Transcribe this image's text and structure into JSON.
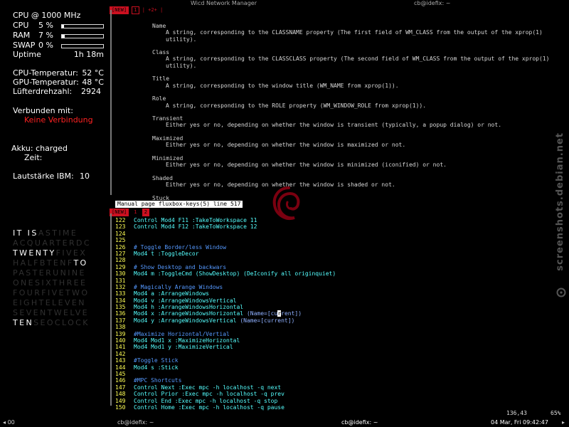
{
  "conky": {
    "cpu_header": "CPU @ 1000 MHz",
    "rows": [
      {
        "label": "CPU",
        "value": "5 %",
        "percent": 5
      },
      {
        "label": "RAM",
        "value": "7 %",
        "percent": 7
      },
      {
        "label": "SWAP",
        "value": "0 %",
        "percent": 0
      }
    ],
    "uptime_label": "Uptime",
    "uptime_value": "1h 18m",
    "cpu_temp_label": "CPU-Temperatur:",
    "cpu_temp_value": "52 °C",
    "gpu_temp_label": "GPU-Temperatur:",
    "gpu_temp_value": "48 °C",
    "fan_label": "Lüfterdrehzahl:",
    "fan_value": "2924",
    "connected_label": "Verbunden mit:",
    "connected_value": "Keine Verbindung",
    "battery_label": "Akku: charged",
    "time_label": "Zeit:",
    "volume_label": "Lautstärke IBM:",
    "volume_value": "10"
  },
  "word_clock": [
    [
      {
        "t": "IT",
        "on": true
      },
      {
        "t": " ",
        "on": false
      },
      {
        "t": "IS",
        "on": true
      },
      {
        "t": "ASTIME",
        "on": false
      }
    ],
    [
      {
        "t": "ACQUARTERDC",
        "on": false
      }
    ],
    [
      {
        "t": "TWENTY",
        "on": true
      },
      {
        "t": "FIVEX",
        "on": false
      }
    ],
    [
      {
        "t": "HALFBTENF",
        "on": false
      },
      {
        "t": "TO",
        "on": true
      }
    ],
    [
      {
        "t": "PASTERUNINE",
        "on": false
      }
    ],
    [
      {
        "t": "ONESIXTHREE",
        "on": false
      }
    ],
    [
      {
        "t": "FOURFIVETWO",
        "on": false
      }
    ],
    [
      {
        "t": "EIGHTELEVEN",
        "on": false
      }
    ],
    [
      {
        "t": "SEVENTWELVE",
        "on": false
      }
    ],
    [
      {
        "t": "TEN",
        "on": true
      },
      {
        "t": "SEOCLOCK",
        "on": false
      }
    ]
  ],
  "window": {
    "title": "Wicd Network Manager",
    "terminal_title": "cb@idefix: ~"
  },
  "top_tabs": {
    "a": "[NEW]",
    "b": "1",
    "rest": "| +2+ |"
  },
  "man_page": [
    {
      "text": "Name",
      "indent": 0
    },
    {
      "text": "A string, corresponding to the CLASSNAME property (The first field of WM_CLASS from the output of the xprop(1)",
      "indent": 1
    },
    {
      "text": "utility).",
      "indent": 1
    },
    {
      "text": "",
      "indent": 0
    },
    {
      "text": "Class",
      "indent": 0
    },
    {
      "text": "A string, corresponding to the CLASSCLASS property (The second field of WM_CLASS from the output of the xprop(1)",
      "indent": 1
    },
    {
      "text": "utility).",
      "indent": 1
    },
    {
      "text": "",
      "indent": 0
    },
    {
      "text": "Title",
      "indent": 0
    },
    {
      "text": "A string, corresponding to the window title (WM_NAME from xprop(1)).",
      "indent": 1
    },
    {
      "text": "",
      "indent": 0
    },
    {
      "text": "Role",
      "indent": 0
    },
    {
      "text": "A string, corresponding to the ROLE property (WM_WINDOW_ROLE from xprop(1)).",
      "indent": 1
    },
    {
      "text": "",
      "indent": 0
    },
    {
      "text": "Transient",
      "indent": 0
    },
    {
      "text": "Either yes or no, depending on whether the window is transient (typically, a popup dialog) or not.",
      "indent": 1
    },
    {
      "text": "",
      "indent": 0
    },
    {
      "text": "Maximized",
      "indent": 0
    },
    {
      "text": "Either yes or no, depending on whether the window is maximized or not.",
      "indent": 1
    },
    {
      "text": "",
      "indent": 0
    },
    {
      "text": "Minimized",
      "indent": 0
    },
    {
      "text": "Either yes or no, depending on whether the window is minimized (iconified) or not.",
      "indent": 1
    },
    {
      "text": "",
      "indent": 0
    },
    {
      "text": "Shaded",
      "indent": 0
    },
    {
      "text": "Either yes or no, depending on whether the window is shaded or not.",
      "indent": 1
    },
    {
      "text": "",
      "indent": 0
    },
    {
      "text": "Stuck",
      "indent": 0
    }
  ],
  "man_status": "Manual page fluxbox-keys(5) line 517",
  "mid_tabs": {
    "a": "[NEW]",
    "b": "1",
    "c": "2"
  },
  "vim_lines": [
    {
      "n": "122",
      "parts": [
        {
          "c": "kw",
          "t": "Control Mod4 F11 :TakeToWorkspace 11"
        }
      ]
    },
    {
      "n": "123",
      "parts": [
        {
          "c": "kw",
          "t": "Control Mod4 F12 :TakeToWorkspace 12"
        }
      ]
    },
    {
      "n": "124",
      "parts": []
    },
    {
      "n": "125",
      "parts": []
    },
    {
      "n": "126",
      "parts": [
        {
          "c": "cm",
          "t": "# Toggle Border/less Window"
        }
      ]
    },
    {
      "n": "127",
      "parts": [
        {
          "c": "kw",
          "t": "Mod4 t :ToggleDecor"
        }
      ]
    },
    {
      "n": "128",
      "parts": []
    },
    {
      "n": "129",
      "parts": [
        {
          "c": "cm",
          "t": "# Show Desktop and backwars"
        }
      ]
    },
    {
      "n": "130",
      "parts": [
        {
          "c": "kw",
          "t": "Mod4 m :ToggleCmd (ShowDesktop) (DeIconify all originquiet)"
        }
      ]
    },
    {
      "n": "131",
      "parts": []
    },
    {
      "n": "132",
      "parts": [
        {
          "c": "cm",
          "t": "# Magically Arange Windows"
        }
      ]
    },
    {
      "n": "133",
      "parts": [
        {
          "c": "kw",
          "t": "Mod4 a :ArrangeWindows"
        }
      ]
    },
    {
      "n": "134",
      "parts": [
        {
          "c": "kw",
          "t": "Mod4 v :ArrangeWindowsVertical"
        }
      ]
    },
    {
      "n": "135",
      "parts": [
        {
          "c": "kw",
          "t": "Mod4 h :ArrangeWindowsHorizontal"
        }
      ]
    },
    {
      "n": "136",
      "parts": [
        {
          "c": "kw",
          "t": "Mod4 x :ArrangeWindowsHorizontal "
        },
        {
          "c": "ar",
          "t": "(Name=[cu"
        },
        {
          "c": "cursor",
          "t": "r"
        },
        {
          "c": "ar",
          "t": "rent])"
        }
      ]
    },
    {
      "n": "137",
      "parts": [
        {
          "c": "kw",
          "t": "Mod4 y :ArrangeWindowsVertical "
        },
        {
          "c": "ar",
          "t": "(Name=[current])"
        }
      ]
    },
    {
      "n": "138",
      "parts": []
    },
    {
      "n": "139",
      "parts": [
        {
          "c": "cm",
          "t": "#Maximize Horizontal/Vertial"
        }
      ]
    },
    {
      "n": "140",
      "parts": [
        {
          "c": "kw",
          "t": "Mod4 Mod1 x :MaximizeHorizontal"
        }
      ]
    },
    {
      "n": "141",
      "parts": [
        {
          "c": "kw",
          "t": "Mod4 Mod1 y :MaximizeVertical"
        }
      ]
    },
    {
      "n": "142",
      "parts": []
    },
    {
      "n": "143",
      "parts": [
        {
          "c": "cm",
          "t": "#Toggle Stick"
        }
      ]
    },
    {
      "n": "144",
      "parts": [
        {
          "c": "kw",
          "t": "Mod4 s :Stick"
        }
      ]
    },
    {
      "n": "145",
      "parts": []
    },
    {
      "n": "146",
      "parts": [
        {
          "c": "cm",
          "t": "#MPC Shortcuts"
        }
      ]
    },
    {
      "n": "147",
      "parts": [
        {
          "c": "kw",
          "t": "Control Next :Exec mpc -h localhost -q next"
        }
      ]
    },
    {
      "n": "148",
      "parts": [
        {
          "c": "kw",
          "t": "Control Prior :Exec mpc -h localhost -q prev"
        }
      ]
    },
    {
      "n": "149",
      "parts": [
        {
          "c": "kw",
          "t": "Control End :Exec mpc -h localhost -q stop"
        }
      ]
    },
    {
      "n": "150",
      "parts": [
        {
          "c": "kw",
          "t": "Control Home :Exec mpc -h localhost -q pause"
        }
      ]
    }
  ],
  "vim_position": "136,43",
  "vim_percent": "65%",
  "watermark": "screenshots.debian.net",
  "taskbar": {
    "left": "00",
    "task1": "cb@idefix: ~",
    "task2": "cb@idefix: ~",
    "clock": "04 Mar, Fri 09:42:47"
  },
  "colors": {
    "accent_red": "#cc1020",
    "syntax_keyword": "#55ffff",
    "syntax_comment": "#5599ff",
    "line_number": "#ffff55"
  }
}
